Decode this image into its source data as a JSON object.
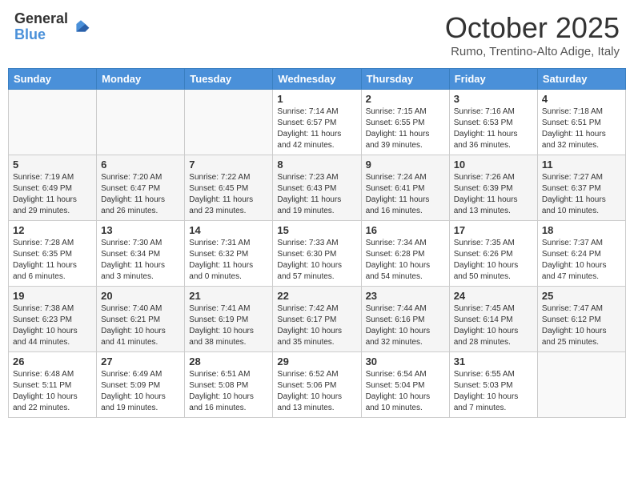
{
  "header": {
    "logo_general": "General",
    "logo_blue": "Blue",
    "month_title": "October 2025",
    "subtitle": "Rumo, Trentino-Alto Adige, Italy"
  },
  "weekdays": [
    "Sunday",
    "Monday",
    "Tuesday",
    "Wednesday",
    "Thursday",
    "Friday",
    "Saturday"
  ],
  "weeks": [
    [
      {
        "day": "",
        "info": ""
      },
      {
        "day": "",
        "info": ""
      },
      {
        "day": "",
        "info": ""
      },
      {
        "day": "1",
        "info": "Sunrise: 7:14 AM\nSunset: 6:57 PM\nDaylight: 11 hours and 42 minutes."
      },
      {
        "day": "2",
        "info": "Sunrise: 7:15 AM\nSunset: 6:55 PM\nDaylight: 11 hours and 39 minutes."
      },
      {
        "day": "3",
        "info": "Sunrise: 7:16 AM\nSunset: 6:53 PM\nDaylight: 11 hours and 36 minutes."
      },
      {
        "day": "4",
        "info": "Sunrise: 7:18 AM\nSunset: 6:51 PM\nDaylight: 11 hours and 32 minutes."
      }
    ],
    [
      {
        "day": "5",
        "info": "Sunrise: 7:19 AM\nSunset: 6:49 PM\nDaylight: 11 hours and 29 minutes."
      },
      {
        "day": "6",
        "info": "Sunrise: 7:20 AM\nSunset: 6:47 PM\nDaylight: 11 hours and 26 minutes."
      },
      {
        "day": "7",
        "info": "Sunrise: 7:22 AM\nSunset: 6:45 PM\nDaylight: 11 hours and 23 minutes."
      },
      {
        "day": "8",
        "info": "Sunrise: 7:23 AM\nSunset: 6:43 PM\nDaylight: 11 hours and 19 minutes."
      },
      {
        "day": "9",
        "info": "Sunrise: 7:24 AM\nSunset: 6:41 PM\nDaylight: 11 hours and 16 minutes."
      },
      {
        "day": "10",
        "info": "Sunrise: 7:26 AM\nSunset: 6:39 PM\nDaylight: 11 hours and 13 minutes."
      },
      {
        "day": "11",
        "info": "Sunrise: 7:27 AM\nSunset: 6:37 PM\nDaylight: 11 hours and 10 minutes."
      }
    ],
    [
      {
        "day": "12",
        "info": "Sunrise: 7:28 AM\nSunset: 6:35 PM\nDaylight: 11 hours and 6 minutes."
      },
      {
        "day": "13",
        "info": "Sunrise: 7:30 AM\nSunset: 6:34 PM\nDaylight: 11 hours and 3 minutes."
      },
      {
        "day": "14",
        "info": "Sunrise: 7:31 AM\nSunset: 6:32 PM\nDaylight: 11 hours and 0 minutes."
      },
      {
        "day": "15",
        "info": "Sunrise: 7:33 AM\nSunset: 6:30 PM\nDaylight: 10 hours and 57 minutes."
      },
      {
        "day": "16",
        "info": "Sunrise: 7:34 AM\nSunset: 6:28 PM\nDaylight: 10 hours and 54 minutes."
      },
      {
        "day": "17",
        "info": "Sunrise: 7:35 AM\nSunset: 6:26 PM\nDaylight: 10 hours and 50 minutes."
      },
      {
        "day": "18",
        "info": "Sunrise: 7:37 AM\nSunset: 6:24 PM\nDaylight: 10 hours and 47 minutes."
      }
    ],
    [
      {
        "day": "19",
        "info": "Sunrise: 7:38 AM\nSunset: 6:23 PM\nDaylight: 10 hours and 44 minutes."
      },
      {
        "day": "20",
        "info": "Sunrise: 7:40 AM\nSunset: 6:21 PM\nDaylight: 10 hours and 41 minutes."
      },
      {
        "day": "21",
        "info": "Sunrise: 7:41 AM\nSunset: 6:19 PM\nDaylight: 10 hours and 38 minutes."
      },
      {
        "day": "22",
        "info": "Sunrise: 7:42 AM\nSunset: 6:17 PM\nDaylight: 10 hours and 35 minutes."
      },
      {
        "day": "23",
        "info": "Sunrise: 7:44 AM\nSunset: 6:16 PM\nDaylight: 10 hours and 32 minutes."
      },
      {
        "day": "24",
        "info": "Sunrise: 7:45 AM\nSunset: 6:14 PM\nDaylight: 10 hours and 28 minutes."
      },
      {
        "day": "25",
        "info": "Sunrise: 7:47 AM\nSunset: 6:12 PM\nDaylight: 10 hours and 25 minutes."
      }
    ],
    [
      {
        "day": "26",
        "info": "Sunrise: 6:48 AM\nSunset: 5:11 PM\nDaylight: 10 hours and 22 minutes."
      },
      {
        "day": "27",
        "info": "Sunrise: 6:49 AM\nSunset: 5:09 PM\nDaylight: 10 hours and 19 minutes."
      },
      {
        "day": "28",
        "info": "Sunrise: 6:51 AM\nSunset: 5:08 PM\nDaylight: 10 hours and 16 minutes."
      },
      {
        "day": "29",
        "info": "Sunrise: 6:52 AM\nSunset: 5:06 PM\nDaylight: 10 hours and 13 minutes."
      },
      {
        "day": "30",
        "info": "Sunrise: 6:54 AM\nSunset: 5:04 PM\nDaylight: 10 hours and 10 minutes."
      },
      {
        "day": "31",
        "info": "Sunrise: 6:55 AM\nSunset: 5:03 PM\nDaylight: 10 hours and 7 minutes."
      },
      {
        "day": "",
        "info": ""
      }
    ]
  ]
}
